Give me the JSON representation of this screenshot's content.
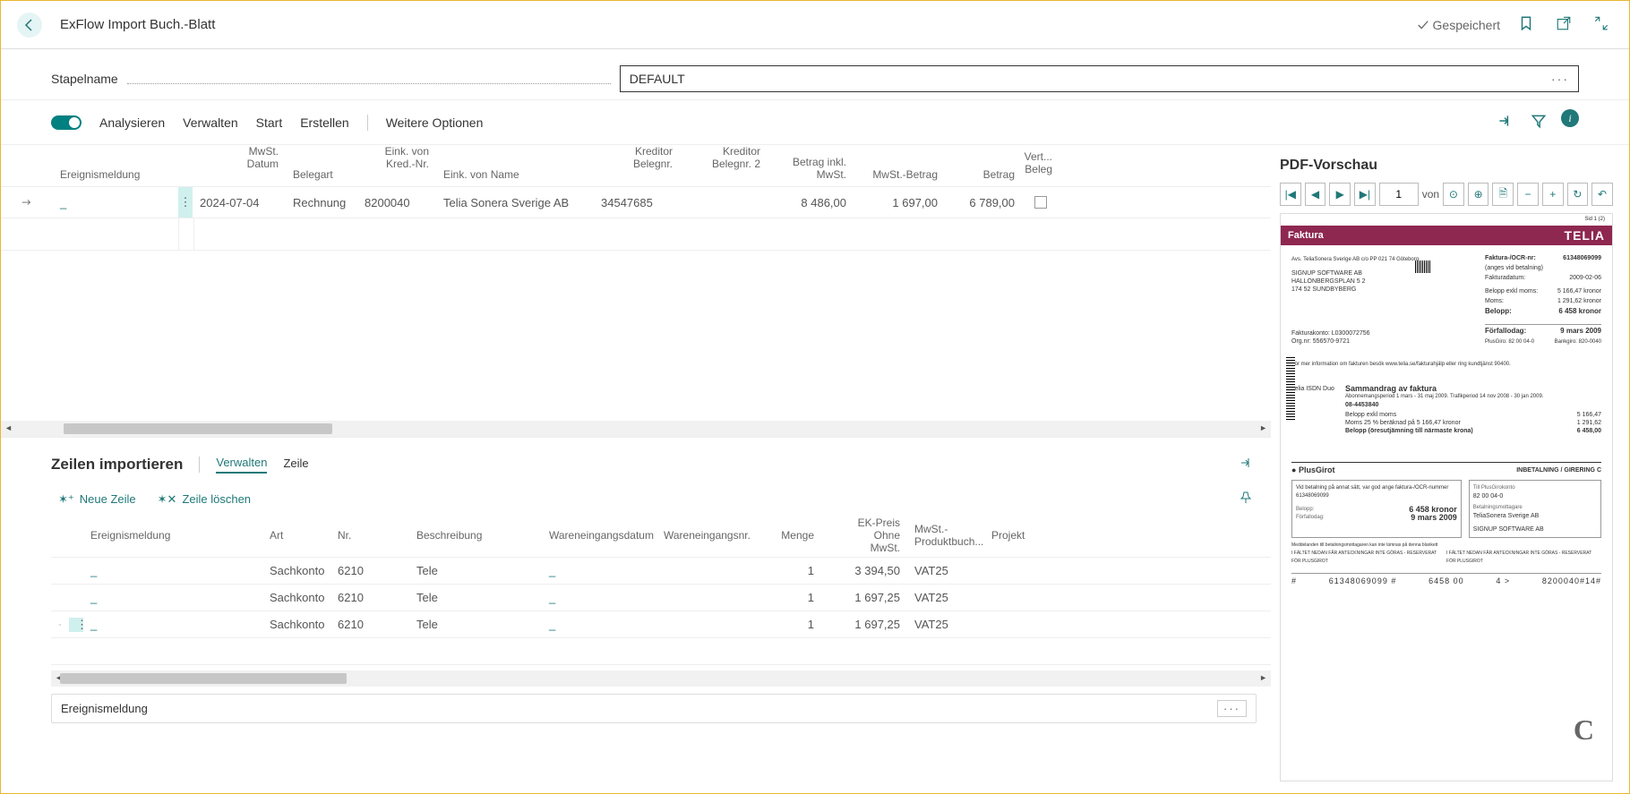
{
  "header": {
    "title": "ExFlow Import Buch.-Blatt",
    "saved": "Gespeichert"
  },
  "batch": {
    "label": "Stapelname",
    "value": "DEFAULT"
  },
  "toolbar": {
    "analyze": "Analysieren",
    "manage": "Verwalten",
    "start": "Start",
    "create": "Erstellen",
    "more": "Weitere Optionen"
  },
  "grid1": {
    "cols": {
      "ereignis": "Ereignismeldung",
      "mwst_datum_l1": "MwSt.",
      "mwst_datum_l2": "Datum",
      "belegart": "Belegart",
      "eink_von_l1": "Eink. von",
      "eink_von_l2": "Kred.-Nr.",
      "eink_name": "Eink. von Name",
      "kred_beleg_l1": "Kreditor",
      "kred_beleg_l2": "Belegnr.",
      "kred_beleg2_l1": "Kreditor",
      "kred_beleg2_l2": "Belegnr. 2",
      "betrag_inkl_l1": "Betrag inkl.",
      "betrag_inkl_l2": "MwSt.",
      "mwst_betrag": "MwSt.-Betrag",
      "betrag": "Betrag",
      "vert_l1": "Vert...",
      "vert_l2": "Beleg"
    },
    "row": {
      "ereignis": "_",
      "mwst_datum": "2024-07-04",
      "belegart": "Rechnung",
      "eink_nr": "8200040",
      "eink_name": "Telia Sonera Sverige AB",
      "kred_beleg": "34547685",
      "kred_beleg2": "",
      "betrag_inkl": "8 486,00",
      "mwst_betrag": "1 697,00",
      "betrag": "6 789,00"
    }
  },
  "section2": {
    "title": "Zeilen importieren",
    "tab_manage": "Verwalten",
    "tab_line": "Zeile",
    "new_line": "Neue Zeile",
    "delete_line": "Zeile löschen"
  },
  "grid2": {
    "cols": {
      "ereignis": "Ereignismeldung",
      "art": "Art",
      "nr": "Nr.",
      "beschreibung": "Beschreibung",
      "wareneingangsdatum": "Wareneingangsdatum",
      "wareneingangsnr": "Wareneingangsnr.",
      "menge": "Menge",
      "ekp_l1": "EK-Preis Ohne",
      "ekp_l2": "MwSt.",
      "mwp_l1": "MwSt.-",
      "mwp_l2": "Produktbuch...",
      "projekt": "Projekt"
    },
    "rows": [
      {
        "e": "_",
        "art": "Sachkonto",
        "nr": "6210",
        "bes": "Tele",
        "wed": "_",
        "menge": "1",
        "ekp": "3 394,50",
        "mwp": "VAT25"
      },
      {
        "e": "_",
        "art": "Sachkonto",
        "nr": "6210",
        "bes": "Tele",
        "wed": "_",
        "menge": "1",
        "ekp": "1 697,25",
        "mwp": "VAT25"
      },
      {
        "e": "_",
        "art": "Sachkonto",
        "nr": "6210",
        "bes": "Tele",
        "wed": "_",
        "menge": "1",
        "ekp": "1 697,25",
        "mwp": "VAT25"
      }
    ]
  },
  "footer": {
    "ereignis": "Ereignismeldung"
  },
  "pdf": {
    "title": "PDF-Vorschau",
    "page": "1",
    "von": "von",
    "doc": {
      "faktura": "Faktura",
      "brand": "TELIA",
      "sid": "Sid 1 (2)",
      "ocr_label": "Faktura-/OCR-nr:",
      "ocr": "61348069099",
      "sub_ocr": "(anges vid betalning)",
      "fakturadatum_l": "Fakturadatum:",
      "fakturadatum": "2009-02-06",
      "belopp_exkl_l": "Belopp exkl moms:",
      "belopp_exkl": "5 166,47 kronor",
      "moms_l": "Moms:",
      "moms": "1 291,62 kronor",
      "belopp_l": "Belopp:",
      "belopp": "6 458 kronor",
      "addr1": "Avs. TeliaSonera Sverige AB c/o PP 021 74 Göteborg",
      "addr2": "SIGNUP SOFTWARE AB",
      "addr3": "HALLONBERGSPLAN 5 2",
      "addr4": "174 52   SUNDBYBERG",
      "fakturakonto_l": "Fakturakonto: L0300072756",
      "orgnr_l": "Org.nr: 556570-9721",
      "forfall_l": "Förfallodag:",
      "forfall": "9 mars 2009",
      "plus_l": "PlusGiro: 82 00 04-0",
      "bank_l": "Bankgiro: 820-0040",
      "info": "För mer information om fakturen besök www.telia.se/fakturahjälp eller ring kundtjänst 90400.",
      "telia_isdn": "Telia ISDN Duo",
      "samm_title": "Sammandrag av faktura",
      "samm_sub": "Abonnemangsperiod 1 mars - 31 maj 2009. Trafikperiod 14 nov 2008 - 30 jan 2009.",
      "samm_acc": "08-4453840",
      "samm_r1_l": "Belopp exkl moms",
      "samm_r1_v": "5 166,47",
      "samm_r2_l": "Moms 25 % beräknad på 5 166,47 kronor",
      "samm_r2_v": "1 291,62",
      "samm_r3_l": "Belopp (öresutjämning till närmaste krona)",
      "samm_r3_v": "6 458,00",
      "plusgirot": "PlusGirot",
      "inbet": "INBETALNING / GIRERING C",
      "pay_hint": "Vid betalning på annat sätt, var god ange faktura-/OCR-nummer 61348069099",
      "belopp_box_l": "Belopp:",
      "belopp_box": "6 458 kronor",
      "forfall_box_l": "Förfallodag:",
      "forfall_box": "9 mars 2009",
      "till_konto_l": "Till PlusGirokonto",
      "till_konto": "82 00 04-0",
      "mottagare_l": "Betalningsmottagare",
      "mottagare": "TeliaSonera Sverige AB",
      "avsandare": "SIGNUP SOFTWARE AB",
      "note1": "Meddelanden till betalningsmottagaren kan inte lämnas på denna blankett",
      "note2": "I FÄLTET NEDAN FÅR ANTECKNINGAR INTE GÖRAS - RESERVERAT FÖR PLUSGIROT",
      "ocrline_1": "#",
      "ocrline_2": "61348069099 #",
      "ocrline_3": "6458 00",
      "ocrline_4": "4   >",
      "ocrline_5": "8200040#14#"
    }
  }
}
